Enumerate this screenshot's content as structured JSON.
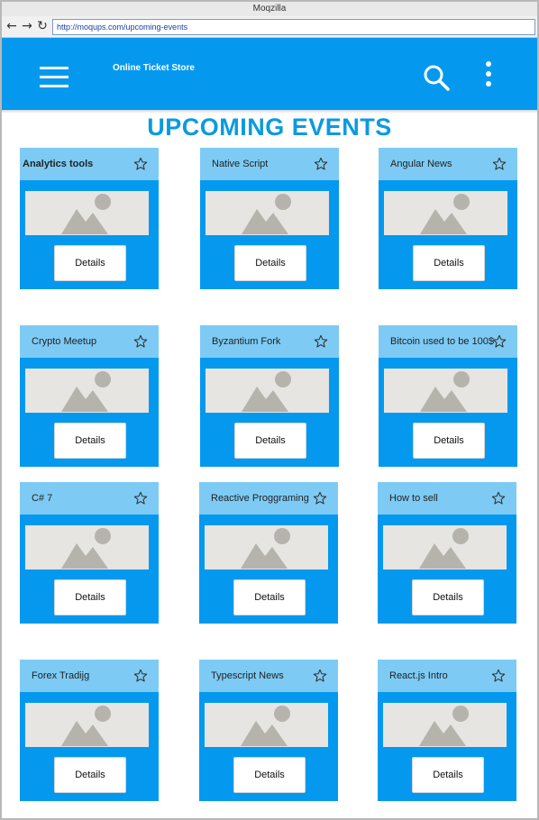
{
  "browser": {
    "window_title": "Moqzilla",
    "url": "http://moqups.com/upcoming-events",
    "back_glyph": "←",
    "forward_glyph": "→",
    "reload_glyph": "↻"
  },
  "appbar": {
    "title": "Online Ticket Store",
    "icons": [
      "hamburger-menu-icon",
      "search-icon",
      "more-vert-icon"
    ],
    "color": "#0499ef"
  },
  "page": {
    "heading": "UPCOMING EVENTS",
    "heading_color": "#0b9ae0"
  },
  "colors": {
    "card_body": "#0499ef",
    "card_header": "#7dcbf5"
  },
  "events": [
    {
      "title": "Analytics tools",
      "button": "Details"
    },
    {
      "title": "Native Script",
      "button": "Details"
    },
    {
      "title": "Angular News",
      "button": "Details"
    },
    {
      "title": "Crypto Meetup",
      "button": "Details"
    },
    {
      "title": "Byzantium Fork",
      "button": "Details"
    },
    {
      "title": "Bitcoin used to be 100$",
      "button": "Details"
    },
    {
      "title": "C# 7",
      "button": "Details"
    },
    {
      "title": "Reactive Proggraming",
      "button": "Details"
    },
    {
      "title": "How to sell",
      "button": "Details"
    },
    {
      "title": "Forex Tradijg",
      "button": "Details"
    },
    {
      "title": "Typescript News",
      "button": "Details"
    },
    {
      "title": "React.js Intro",
      "button": "Details"
    }
  ]
}
